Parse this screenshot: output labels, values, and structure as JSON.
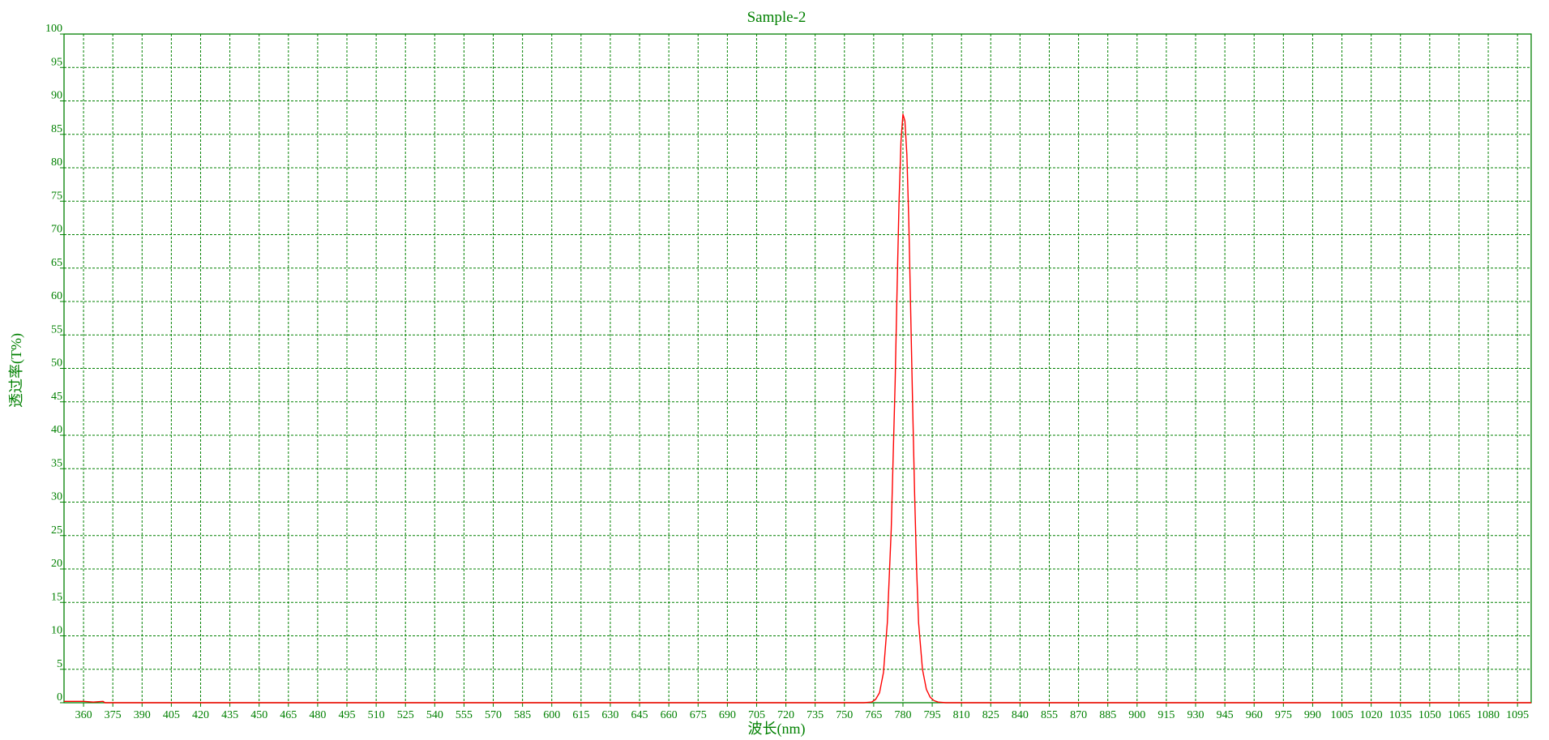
{
  "colors": {
    "axis": "#008000",
    "grid": "#008000",
    "text": "#008000",
    "series": "#ff0000",
    "background": "#ffffff"
  },
  "chart_data": {
    "type": "line",
    "title": "Sample-2",
    "xlabel": "波长(nm)",
    "ylabel": "透过率(T%)",
    "xlim": [
      350,
      1102
    ],
    "ylim": [
      0,
      100
    ],
    "grid": true,
    "legend": "none",
    "x_ticks": [
      360,
      375,
      390,
      405,
      420,
      435,
      450,
      465,
      480,
      495,
      510,
      525,
      540,
      555,
      570,
      585,
      600,
      615,
      630,
      645,
      660,
      675,
      690,
      705,
      720,
      735,
      750,
      765,
      780,
      795,
      810,
      825,
      840,
      855,
      870,
      885,
      900,
      915,
      930,
      945,
      960,
      975,
      990,
      1005,
      1020,
      1035,
      1050,
      1065,
      1080,
      1095
    ],
    "y_ticks": [
      0,
      5,
      10,
      15,
      20,
      25,
      30,
      35,
      40,
      45,
      50,
      55,
      60,
      65,
      70,
      75,
      80,
      85,
      90,
      95,
      100
    ],
    "series": [
      {
        "color": "#ff0000",
        "x": [
          350,
          360,
          365,
          370,
          371,
          760,
          764,
          766,
          768,
          770,
          772,
          774,
          776,
          777,
          778,
          779,
          780,
          781,
          782,
          783,
          784,
          785,
          786,
          787,
          788,
          790,
          792,
          794,
          796,
          798,
          802,
          1102
        ],
        "y": [
          0.2,
          0.2,
          0.1,
          0.2,
          0.0,
          0.0,
          0.1,
          0.5,
          1.5,
          4.5,
          12,
          26,
          48,
          62,
          75,
          84,
          88,
          87,
          82,
          72,
          58,
          44,
          31,
          20,
          12,
          5,
          2,
          0.8,
          0.3,
          0.1,
          0.0,
          0.0
        ]
      }
    ]
  }
}
